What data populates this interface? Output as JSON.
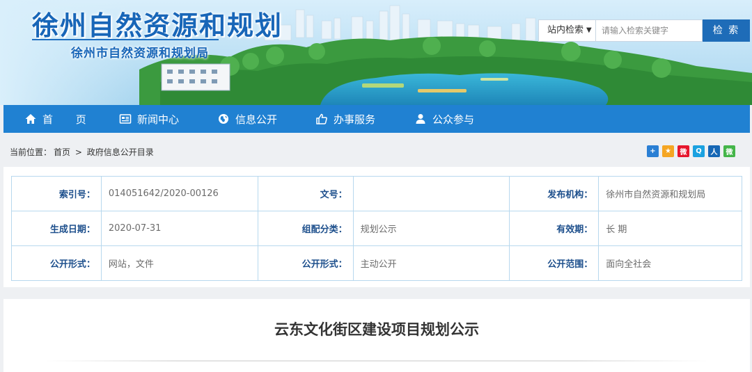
{
  "header": {
    "title": "徐州自然资源和规划",
    "subtitle": "徐州市自然资源和规划局"
  },
  "search": {
    "scope": "站内检索",
    "placeholder": "请输入检索关键字",
    "button": "检 索"
  },
  "nav": [
    {
      "label": "首 页",
      "icon": "home-icon"
    },
    {
      "label": "新闻中心",
      "icon": "newspaper-icon"
    },
    {
      "label": "信息公开",
      "icon": "globe-icon"
    },
    {
      "label": "办事服务",
      "icon": "thumbs-up-icon"
    },
    {
      "label": "公众参与",
      "icon": "user-icon"
    }
  ],
  "breadcrumb": {
    "prefix": "当前位置：",
    "items": [
      "首页",
      "政府信息公开目录"
    ],
    "separator": ">"
  },
  "share_icons": [
    {
      "name": "share-more-icon",
      "glyph": "+",
      "color": "#2a7fd4"
    },
    {
      "name": "share-qzone-icon",
      "glyph": "★",
      "color": "#f5a623"
    },
    {
      "name": "share-weibo-icon",
      "glyph": "微",
      "color": "#e6162d"
    },
    {
      "name": "share-qq-icon",
      "glyph": "Q",
      "color": "#1aa1e0"
    },
    {
      "name": "share-renren-icon",
      "glyph": "人",
      "color": "#1667b5"
    },
    {
      "name": "share-wechat-icon",
      "glyph": "微",
      "color": "#44b549"
    }
  ],
  "meta": {
    "rows": [
      [
        {
          "label": "索引号：",
          "value": "014051642/2020-00126"
        },
        {
          "label": "文号：",
          "value": ""
        },
        {
          "label": "发布机构：",
          "value": "徐州市自然资源和规划局"
        }
      ],
      [
        {
          "label": "生成日期：",
          "value": "2020-07-31"
        },
        {
          "label": "组配分类：",
          "value": "规划公示"
        },
        {
          "label": "有效期：",
          "value": "长 期"
        }
      ],
      [
        {
          "label": "公开形式：",
          "value": "网站，文件"
        },
        {
          "label": "公开形式：",
          "value": "主动公开"
        },
        {
          "label": "公开范围：",
          "value": "面向全社会"
        }
      ]
    ]
  },
  "article": {
    "title": "云东文化街区建设项目规划公示"
  },
  "colors": {
    "nav": "#2081d2",
    "brand": "#1866b8",
    "search_button": "#1e6cb8",
    "table_border": "#b7d8ee",
    "label": "#1d4f8c"
  }
}
